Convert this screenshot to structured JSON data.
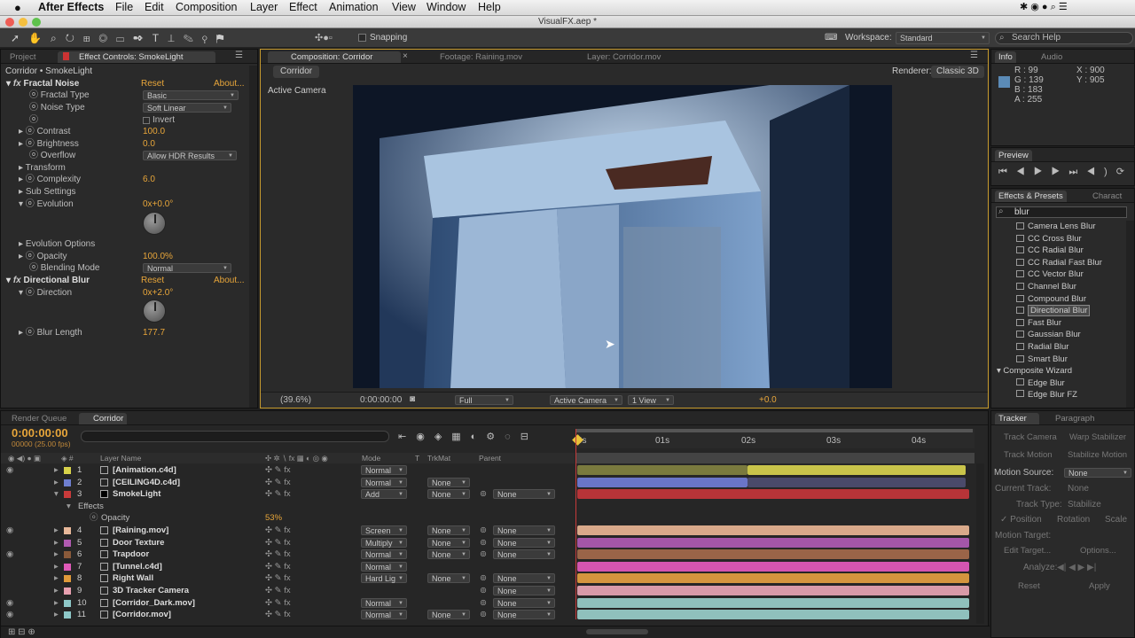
{
  "menubar": {
    "apple": "",
    "app": "After Effects",
    "items": [
      "File",
      "Edit",
      "Composition",
      "Layer",
      "Effect",
      "Animation",
      "View",
      "Window",
      "Help"
    ]
  },
  "window": {
    "title": "VisualFX.aep *"
  },
  "toolbar": {
    "snapping": "Snapping",
    "workspace_label": "Workspace:",
    "workspace_value": "Standard",
    "search_placeholder": "Search Help"
  },
  "left_tabs": {
    "project": "Project",
    "effect_controls": "Effect Controls: SmokeLight"
  },
  "effect": {
    "breadcrumb": "Corridor • SmokeLight",
    "reset": "Reset",
    "about": "About...",
    "rows": [
      {
        "label": "Fractal Noise",
        "value": "Reset",
        "about": "About...",
        "fx": true
      },
      {
        "label": "Fractal Type",
        "value": "Basic"
      },
      {
        "label": "Noise Type",
        "value": "Soft Linear"
      },
      {
        "label": "",
        "value": "Invert"
      },
      {
        "label": "Contrast",
        "value": "100.0"
      },
      {
        "label": "Brightness",
        "value": "0.0"
      },
      {
        "label": "Overflow",
        "value": "Allow HDR Results"
      },
      {
        "label": "Transform",
        "value": ""
      },
      {
        "label": "Complexity",
        "value": "6.0"
      },
      {
        "label": "Sub Settings",
        "value": ""
      },
      {
        "label": "Evolution",
        "value": "0x+0.0°"
      },
      {
        "label": "Evolution Options",
        "value": ""
      },
      {
        "label": "Opacity",
        "value": "100.0%"
      },
      {
        "label": "Blending Mode",
        "value": "Normal"
      },
      {
        "label": "Directional Blur",
        "value": "Reset",
        "about": "About...",
        "fx": true
      },
      {
        "label": "Direction",
        "value": "0x+2.0°"
      },
      {
        "label": "Blur Length",
        "value": "177.7"
      }
    ]
  },
  "comp_tabs": {
    "comp": "Composition: Corridor",
    "footage": "Footage: Raining.mov",
    "layer": "Layer: Corridor.mov"
  },
  "viewer": {
    "crumb": "Corridor",
    "renderer_label": "Renderer:",
    "renderer": "Classic 3D",
    "camera_label": "Active Camera",
    "zoom": "(39.6%)",
    "timecode": "0:00:00:00",
    "res": "Full",
    "view_camera": "Active Camera",
    "views": "1 View",
    "exposure": "+0.0"
  },
  "info": {
    "tab": "Info",
    "audio": "Audio",
    "r": "R : 99",
    "g": "G : 139",
    "b": "B : 183",
    "a": "A : 255",
    "x": "X : 900",
    "y": "Y : 905",
    "swatch": "#5b8bb7"
  },
  "preview": {
    "tab": "Preview"
  },
  "effects_presets": {
    "tab": "Effects & Presets",
    "char_tab": "Charact",
    "search": "blur",
    "items": [
      "Camera Lens Blur",
      "CC Cross Blur",
      "CC Radial Blur",
      "CC Radial Fast Blur",
      "CC Vector Blur",
      "Channel Blur",
      "Compound Blur",
      "Directional Blur",
      "Fast Blur",
      "Gaussian Blur",
      "Radial Blur",
      "Smart Blur"
    ],
    "group": "Composite Wizard",
    "group_items": [
      "Edge Blur",
      "Edge Blur FZ"
    ]
  },
  "timeline": {
    "render_tab": "Render Queue",
    "comp_tab": "Corridor",
    "timecode": "0:00:00:00",
    "fps": "00000 (25.00 fps)",
    "col_layer": "Layer Name",
    "col_mode": "Mode",
    "col_t": "T",
    "col_trk": "TrkMat",
    "col_parent": "Parent",
    "ruler": [
      "0s",
      "01s",
      "02s",
      "03s",
      "04s"
    ],
    "effects_label": "Effects",
    "opacity_label": "Opacity",
    "opacity_value": "53%",
    "layers": [
      {
        "num": "1",
        "name": "[Animation.c4d]",
        "mode": "Normal",
        "trk": "",
        "parent": "",
        "color": "#d8d24a",
        "bar": "#c9c44a"
      },
      {
        "num": "2",
        "name": "[CEILING4D.c4d]",
        "mode": "Normal",
        "trk": "None",
        "parent": "",
        "color": "#6e7fd0",
        "bar": "#6a75c8"
      },
      {
        "num": "3",
        "name": "SmokeLight",
        "mode": "Add",
        "trk": "None",
        "parent": "None",
        "color": "#c83a3a",
        "bar": "#b83438"
      },
      {
        "num": "4",
        "name": "[Raining.mov]",
        "mode": "Screen",
        "trk": "None",
        "parent": "None",
        "color": "#e8b89a",
        "bar": "#d9a98a"
      },
      {
        "num": "5",
        "name": "Door Texture",
        "mode": "Multiply",
        "trk": "None",
        "parent": "None",
        "color": "#b05ab0",
        "bar": "#a456a8"
      },
      {
        "num": "6",
        "name": "Trapdoor",
        "mode": "Normal",
        "trk": "None",
        "parent": "None",
        "color": "#8a5a3a",
        "bar": "#9a6448"
      },
      {
        "num": "7",
        "name": "[Tunnel.c4d]",
        "mode": "Normal",
        "trk": "",
        "parent": "",
        "color": "#e05ab8",
        "bar": "#d455b0"
      },
      {
        "num": "8",
        "name": "Right Wall",
        "mode": "Hard Lig",
        "trk": "None",
        "parent": "None",
        "color": "#e09a3a",
        "bar": "#d4953e"
      },
      {
        "num": "9",
        "name": "3D Tracker Camera",
        "mode": "",
        "trk": "",
        "parent": "None",
        "color": "#e8a0b0",
        "bar": "#d89aa8"
      },
      {
        "num": "10",
        "name": "[Corridor_Dark.mov]",
        "mode": "Normal",
        "trk": "",
        "parent": "None",
        "color": "#8ec8c8",
        "bar": "#8fc0bc"
      },
      {
        "num": "11",
        "name": "[Corridor.mov]",
        "mode": "Normal",
        "trk": "None",
        "parent": "None",
        "color": "#8ec8c8",
        "bar": "#8fc0bc"
      }
    ]
  },
  "tracker": {
    "tab": "Tracker",
    "para_tab": "Paragraph",
    "track_camera": "Track Camera",
    "warp": "Warp Stabilizer",
    "track_motion": "Track Motion",
    "stabilize": "Stabilize Motion",
    "motion_source_label": "Motion Source:",
    "motion_source": "None",
    "current_track_label": "Current Track:",
    "current_track": "None",
    "track_type_label": "Track Type:",
    "track_type": "Stabilize",
    "position": "Position",
    "rotation": "Rotation",
    "scale": "Scale",
    "motion_target": "Motion Target:",
    "edit_target": "Edit Target...",
    "options": "Options...",
    "analyze": "Analyze:",
    "reset": "Reset",
    "apply": "Apply"
  }
}
